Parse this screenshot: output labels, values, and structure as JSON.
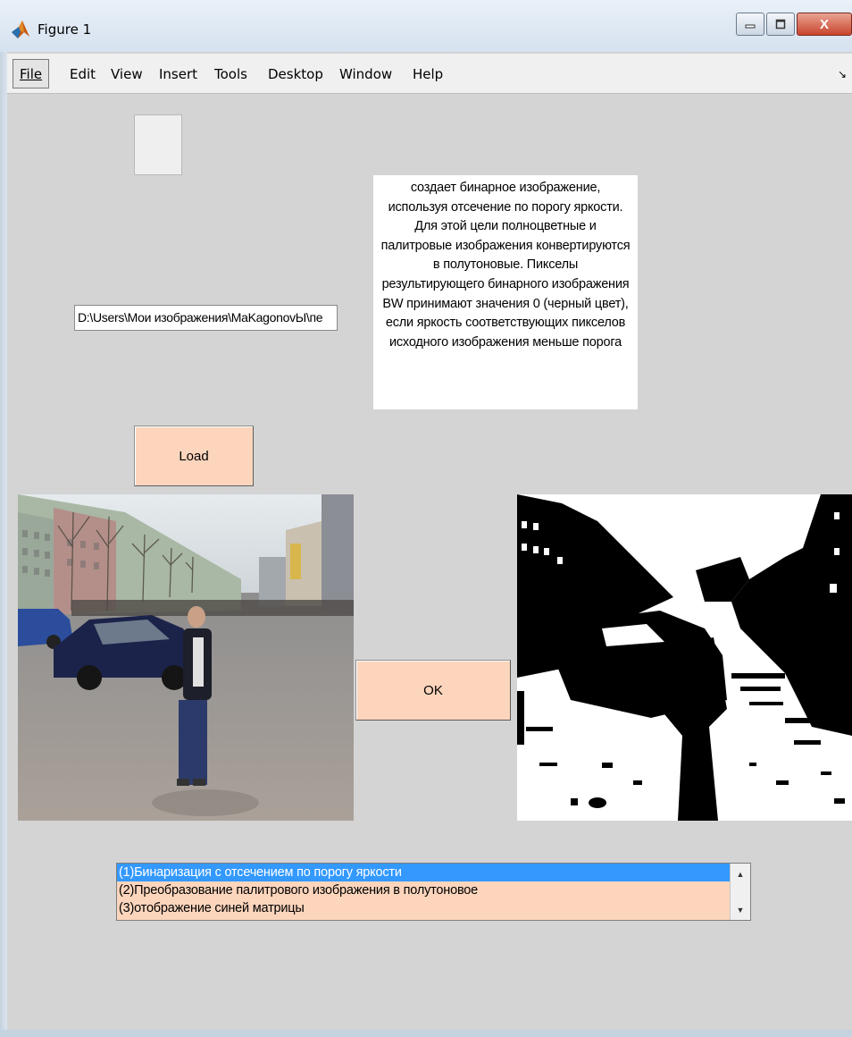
{
  "window": {
    "title": "Figure 1",
    "close_label": "X"
  },
  "menubar": {
    "items": [
      "File",
      "Edit",
      "View",
      "Insert",
      "Tools",
      "Desktop",
      "Window",
      "Help"
    ],
    "dock_glyph": "↘"
  },
  "path_field": {
    "value": "D:\\Users\\Мои изображения\\MaKagonovЫ\\пе"
  },
  "description": {
    "text": "создает бинарное изображение, используя отсечение по порогу яркости. Для этой цели полноцветные и палитровые изображения конвертируются в полутоновые. Пикселы результирующего бинарного изображения BW принимают значения 0 (черный цвет), если яркость соответствующих пикселов исходного изображения меньше порога"
  },
  "buttons": {
    "load": "Load",
    "ok": "OK"
  },
  "listbox": {
    "items": [
      "(1)Бинаризация с отсечением по порогу яркости",
      "(2)Преобразование палитрового изображения в полутоновое",
      "(3)отображение синей матрицы"
    ],
    "selected_index": 0
  },
  "colors": {
    "background": "#d4d4d4",
    "button_fill": "#fcd5bc",
    "list_selection": "#3399ff"
  },
  "icons": {
    "app": "matlab-logo-icon",
    "minimize": "minimize-icon",
    "maximize": "maximize-icon",
    "close": "close-icon"
  }
}
